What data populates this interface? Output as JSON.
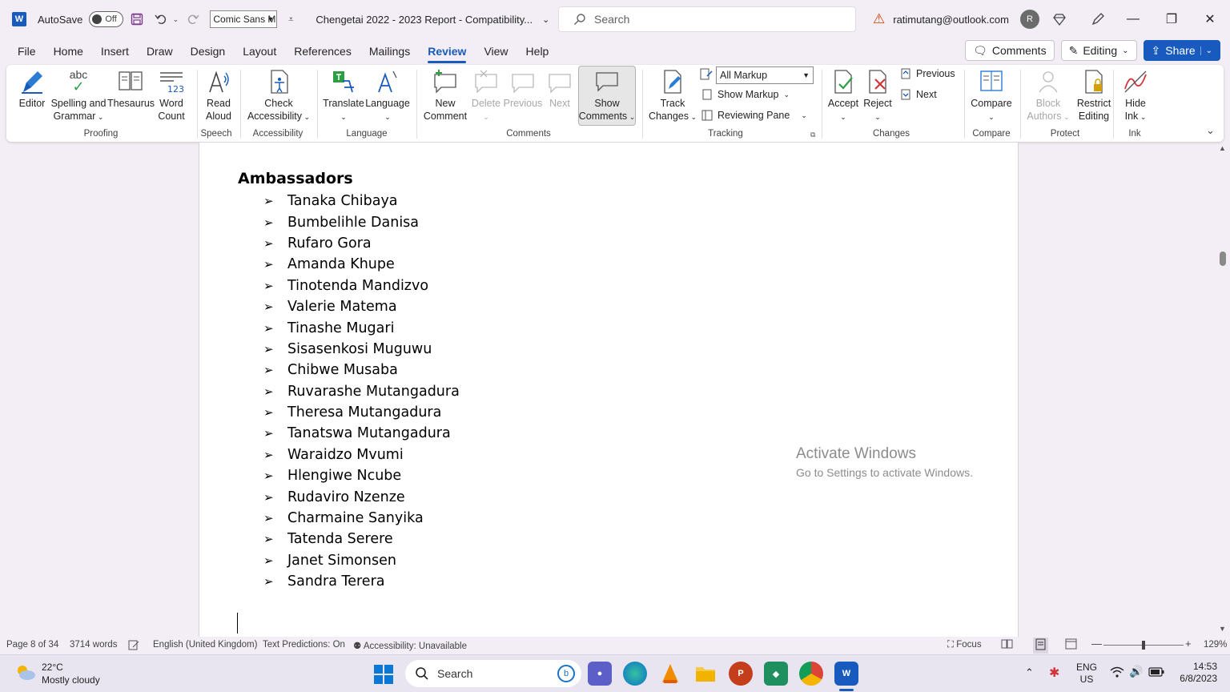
{
  "titlebar": {
    "app_letter": "W",
    "autosave_label": "AutoSave",
    "autosave_state": "Off",
    "font_name": "Comic Sans M",
    "doc_title": "Chengetai 2022 - 2023 Report  -  Compatibility...",
    "search_placeholder": "Search",
    "account_email": "ratimutang@outlook.com",
    "avatar_initial": "R"
  },
  "menu": {
    "tabs": [
      "File",
      "Home",
      "Insert",
      "Draw",
      "Design",
      "Layout",
      "References",
      "Mailings",
      "Review",
      "View",
      "Help"
    ],
    "active_tab": "Review",
    "comments_btn": "Comments",
    "editing_btn": "Editing",
    "share_btn": "Share"
  },
  "ribbon": {
    "proofing": {
      "label": "Proofing",
      "editor": "Editor",
      "spelling_1": "Spelling and",
      "spelling_2": "Grammar",
      "thesaurus": "Thesaurus",
      "wordcount_1": "Word",
      "wordcount_2": "Count",
      "abc": "abc"
    },
    "speech": {
      "label": "Speech",
      "read_1": "Read",
      "read_2": "Aloud"
    },
    "accessibility": {
      "label": "Accessibility",
      "check_1": "Check",
      "check_2": "Accessibility"
    },
    "language": {
      "label": "Language",
      "translate": "Translate",
      "language": "Language"
    },
    "comments": {
      "label": "Comments",
      "new_1": "New",
      "new_2": "Comment",
      "delete": "Delete",
      "previous": "Previous",
      "next": "Next",
      "show_1": "Show",
      "show_2": "Comments"
    },
    "tracking": {
      "label": "Tracking",
      "track_1": "Track",
      "track_2": "Changes",
      "markup_select": "All Markup",
      "show_markup": "Show Markup",
      "reviewing_pane": "Reviewing Pane"
    },
    "changes": {
      "label": "Changes",
      "accept": "Accept",
      "reject": "Reject",
      "previous": "Previous",
      "next": "Next"
    },
    "compare": {
      "label": "Compare",
      "compare": "Compare"
    },
    "protect": {
      "label": "Protect",
      "block_1": "Block",
      "block_2": "Authors",
      "restrict_1": "Restrict",
      "restrict_2": "Editing"
    },
    "ink": {
      "label": "Ink",
      "hide_1": "Hide",
      "hide_2": "Ink"
    }
  },
  "document": {
    "heading": "Ambassadors",
    "items": [
      "Tanaka Chibaya",
      "Bumbelihle Danisa",
      "Rufaro Gora",
      "Amanda Khupe",
      "Tinotenda Mandizvo",
      "Valerie Matema",
      "Tinashe Mugari",
      "Sisasenkosi Muguwu",
      "Chibwe Musaba",
      "Ruvarashe Mutangadura",
      "Theresa Mutangadura",
      "Tanatswa Mutangadura",
      "Waraidzo Mvumi",
      "Hlengiwe Ncube",
      "Rudaviro Nzenze",
      "Charmaine Sanyika",
      "Tatenda Serere",
      "Janet Simonsen",
      "Sandra Terera"
    ],
    "bullet": "➢",
    "watermark_1": "Activate Windows",
    "watermark_2": "Go to Settings to activate Windows."
  },
  "status": {
    "page": "Page 8 of 34",
    "words": "3714 words",
    "language": "English (United Kingdom)",
    "predictions": "Text Predictions: On",
    "accessibility": "Accessibility: Unavailable",
    "focus": "Focus",
    "zoom": "129%"
  },
  "taskbar": {
    "temp": "22°C",
    "weather": "Mostly cloudy",
    "search": "Search",
    "lang_1": "ENG",
    "lang_2": "US",
    "time": "14:53",
    "date": "6/8/2023"
  },
  "colors": {
    "accent": "#185abd",
    "background": "#f3eef6",
    "warning": "#d83b01"
  }
}
